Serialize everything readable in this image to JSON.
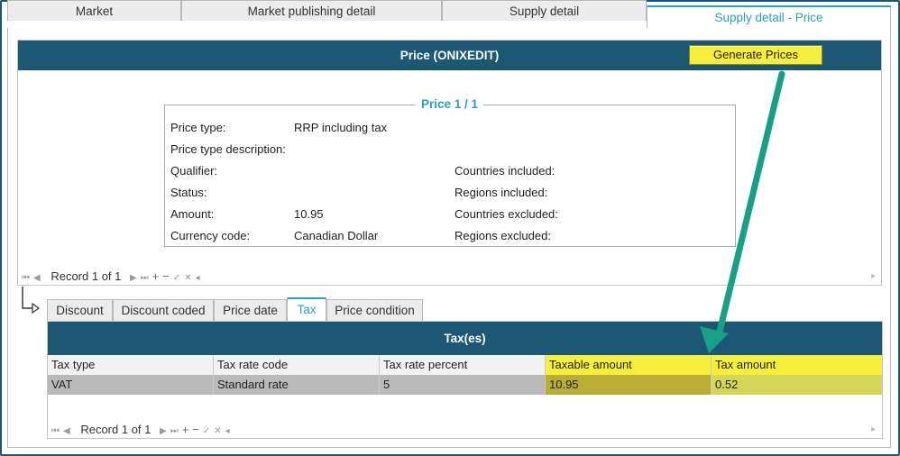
{
  "top_tabs": [
    {
      "label": "Market"
    },
    {
      "label": "Market publishing detail"
    },
    {
      "label": "Supply detail"
    },
    {
      "label": "Supply detail - Price"
    }
  ],
  "price_panel": {
    "title": "Price (ONIXEDIT)",
    "generate_button": "Generate Prices",
    "legend": "Price 1 / 1",
    "fields_left": [
      {
        "label": "Price type:",
        "value": "RRP including tax"
      },
      {
        "label": "Price type description:",
        "value": ""
      },
      {
        "label": "Qualifier:",
        "value": ""
      },
      {
        "label": "Status:",
        "value": ""
      },
      {
        "label": "Amount:",
        "value": "10.95"
      },
      {
        "label": "Currency code:",
        "value": "Canadian Dollar"
      }
    ],
    "fields_right": [
      {
        "label": "Countries included:",
        "value": ""
      },
      {
        "label": "Regions included:",
        "value": ""
      },
      {
        "label": "Countries excluded:",
        "value": ""
      },
      {
        "label": "Regions excluded:",
        "value": ""
      }
    ],
    "record_label": "Record 1 of 1"
  },
  "sub_tabs": [
    {
      "label": "Discount"
    },
    {
      "label": "Discount coded"
    },
    {
      "label": "Price date"
    },
    {
      "label": "Tax"
    },
    {
      "label": "Price condition"
    }
  ],
  "tax_panel": {
    "title": "Tax(es)",
    "columns": [
      "Tax type",
      "Tax rate code",
      "Tax rate percent",
      "Taxable amount",
      "Tax amount"
    ],
    "rows": [
      [
        "VAT",
        "Standard rate",
        "5",
        "10.95",
        "0.52"
      ]
    ],
    "record_label": "Record 1 of 1"
  },
  "colors": {
    "header_bg": "#1c5874",
    "accent": "#2a9fb5",
    "highlight": "#f5ee3c",
    "arrow": "#16a085"
  }
}
